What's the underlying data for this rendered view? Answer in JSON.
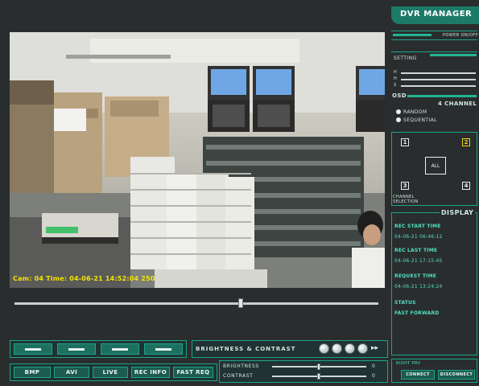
{
  "app": {
    "title": "DVR MANAGER"
  },
  "video": {
    "osd_text": "Cam: 04 Time: 04-06-21 14:52:04 250"
  },
  "playback": {
    "buttons": [
      "rewind",
      "reverse-play",
      "play",
      "fast-forward"
    ]
  },
  "bottom_buttons": [
    "BMP",
    "AVI",
    "LIVE",
    "REC INFO",
    "FAST REQ"
  ],
  "brightness_contrast": {
    "title": "BRIGHTNESS & CONTRAST",
    "brightness_label": "BRIGHTNESS",
    "contrast_label": "CONTRAST",
    "brightness_value": "0",
    "contrast_value": "0"
  },
  "right_panel": {
    "power_label": "POWER ON/OFF",
    "setting_label": "SETTING",
    "osd_label": "OSD",
    "osd_rows": [
      "H",
      "H",
      "S"
    ],
    "channel_title": "4 CHANNEL",
    "channel_modes": [
      "RANDOM",
      "SEQUENTIAL"
    ],
    "channels": [
      "1",
      "2",
      "3",
      "4"
    ],
    "all_label": "ALL",
    "channel_selection": "CHANNEL\nSELECTION",
    "display_title": "DISPLAY",
    "rec_start_label": "REC START TIME",
    "rec_start_value": "04-06-21  06:46:12",
    "rec_last_label": "REC LAST TIME",
    "rec_last_value": "04-06-21  17:15:45",
    "request_label": "REQUEST TIME",
    "request_value": "04-06-21  13:24:24",
    "status_label": "STATUS",
    "status_value": "FAST FORWARD",
    "remote_label": "RIGHT PRV",
    "connect_label": "CONNECT",
    "disconnect_label": "DISCONNECT"
  },
  "colors": {
    "accent": "#1aa58a",
    "text_accent": "#4fe0c0",
    "osd_yellow": "#f4e400",
    "highlight": "#e5d21a"
  }
}
